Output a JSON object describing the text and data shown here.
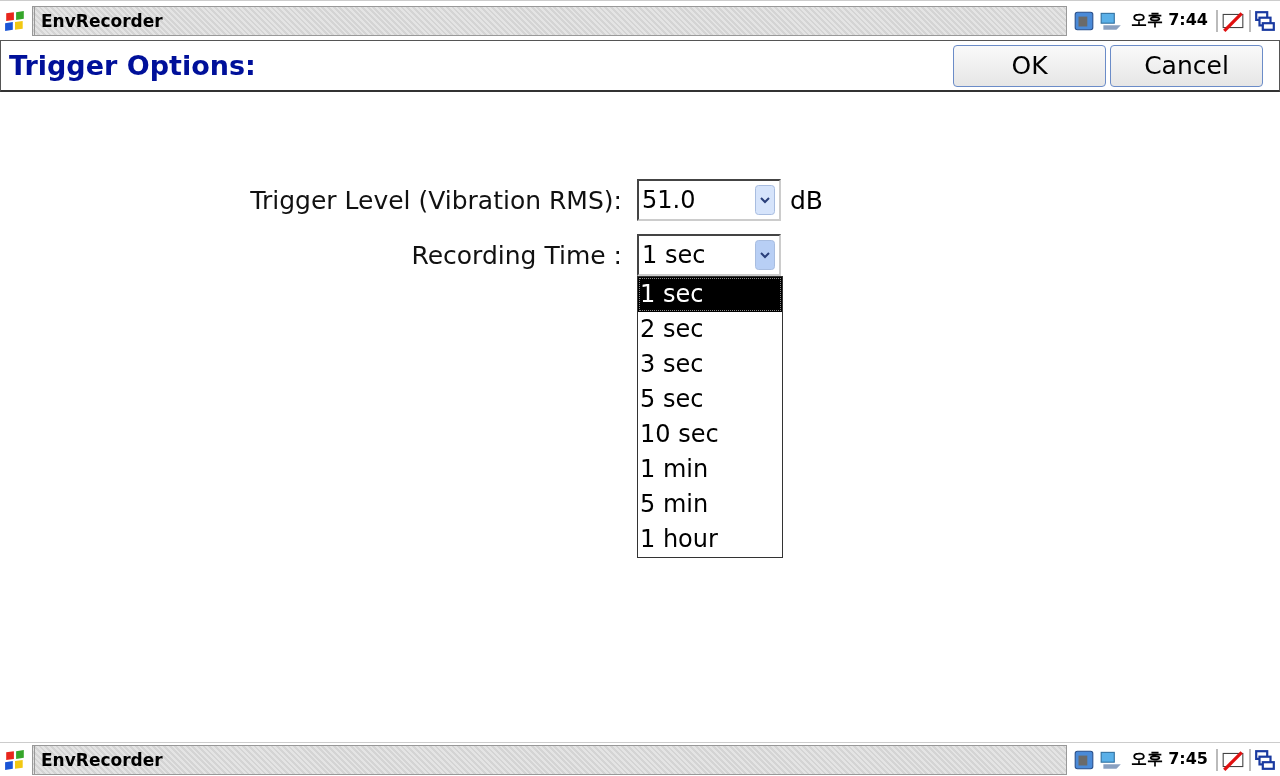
{
  "taskbars": [
    {
      "title": "EnvRecorder",
      "clock": "오후 7:44"
    },
    {
      "title": "EnvRecorder",
      "clock": "오후 7:45"
    }
  ],
  "header": {
    "title": "Trigger Options:",
    "buttons": [
      "OK",
      "Cancel"
    ]
  },
  "fields": [
    {
      "label": "Trigger Level (Vibration RMS):",
      "value": "51.0",
      "unit": "dB",
      "expanded": false
    },
    {
      "label": "Recording Time :",
      "value": "1 sec",
      "expanded": true,
      "options": [
        {
          "label": "1 sec",
          "selected": true
        },
        {
          "label": "2 sec",
          "selected": false
        },
        {
          "label": "3 sec",
          "selected": false
        },
        {
          "label": "5 sec",
          "selected": false
        },
        {
          "label": "10 sec",
          "selected": false
        },
        {
          "label": "1 min",
          "selected": false
        },
        {
          "label": "5 min",
          "selected": false
        },
        {
          "label": "1 hour",
          "selected": false
        }
      ]
    }
  ]
}
